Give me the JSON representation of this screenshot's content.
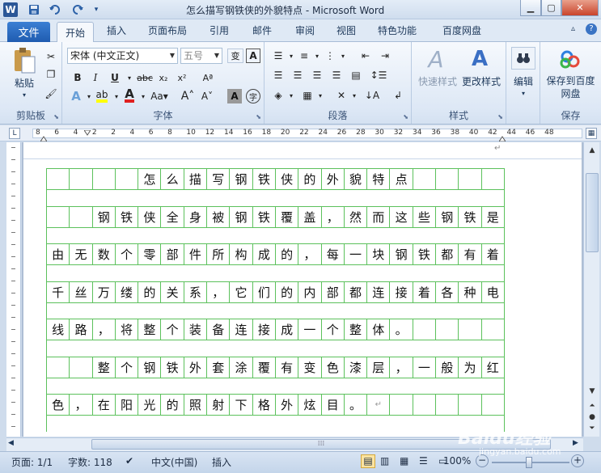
{
  "window": {
    "title": "怎么描写钢铁侠的外貌特点 - Microsoft Word",
    "app_icon": "W"
  },
  "quick_access": {
    "save_icon": "floppy-icon",
    "undo_icon": "undo-icon",
    "redo_icon": "redo-icon",
    "customize_icon": "dropdown-icon"
  },
  "tabs": {
    "file": "文件",
    "items": [
      "开始",
      "插入",
      "页面布局",
      "引用",
      "邮件",
      "审阅",
      "视图",
      "特色功能",
      "百度网盘"
    ]
  },
  "ribbon": {
    "clipboard": {
      "label": "剪贴板",
      "paste": "粘贴"
    },
    "font": {
      "label": "字体",
      "font_name": "宋体 (中文正文)",
      "font_size": "五号",
      "wen_btn": "变"
    },
    "paragraph": {
      "label": "段落"
    },
    "styles": {
      "label": "样式",
      "quick_styles": "快速样式",
      "change_styles": "更改样式"
    },
    "editing": {
      "label": "编辑"
    },
    "save": {
      "label": "保存",
      "save_to_baidu": "保存到百度网盘"
    }
  },
  "ruler": {
    "ticks": [
      "8",
      "6",
      "4",
      "2",
      "2",
      "4",
      "6",
      "8",
      "10",
      "12",
      "14",
      "16",
      "18",
      "20",
      "22",
      "24",
      "26",
      "28",
      "30",
      "32",
      "34",
      "36",
      "38",
      "40",
      "42",
      "44",
      "46",
      "48"
    ]
  },
  "document": {
    "rows": [
      [
        "",
        "",
        "",
        "",
        "怎",
        "么",
        "描",
        "写",
        "钢",
        "铁",
        "侠",
        "的",
        "外",
        "貌",
        "特",
        "点",
        "",
        "",
        "",
        ""
      ],
      [
        "",
        "",
        "钢",
        "铁",
        "侠",
        "全",
        "身",
        "被",
        "钢",
        "铁",
        "覆",
        "盖",
        "，",
        "然",
        "而",
        "这",
        "些",
        "钢",
        "铁",
        "是"
      ],
      [
        "由",
        "无",
        "数",
        "个",
        "零",
        "部",
        "件",
        "所",
        "构",
        "成",
        "的",
        "，",
        "每",
        "一",
        "块",
        "钢",
        "铁",
        "都",
        "有",
        "着"
      ],
      [
        "千",
        "丝",
        "万",
        "缕",
        "的",
        "关",
        "系",
        "，",
        "它",
        "们",
        "的",
        "内",
        "部",
        "都",
        "连",
        "接",
        "着",
        "各",
        "种",
        "电"
      ],
      [
        "线",
        "路",
        "，",
        "将",
        "整",
        "个",
        "装",
        "备",
        "连",
        "接",
        "成",
        "一",
        "个",
        "整",
        "体",
        "。",
        "",
        "",
        "",
        ""
      ],
      [
        "",
        "",
        "整",
        "个",
        "钢",
        "铁",
        "外",
        "套",
        "涂",
        "覆",
        "有",
        "变",
        "色",
        "漆",
        "层",
        "，",
        "一",
        "般",
        "为",
        "红"
      ],
      [
        "色",
        "，",
        "在",
        "阳",
        "光",
        "的",
        "照",
        "射",
        "下",
        "格",
        "外",
        "炫",
        "目",
        "。",
        "↵",
        "",
        "",
        "",
        "",
        ""
      ]
    ]
  },
  "statusbar": {
    "page": "页面: 1/1",
    "words": "字数: 118",
    "language": "中文(中国)",
    "mode": "插入",
    "zoom": "100%",
    "watermark": "Baidu经验",
    "watermark_url": "jingyan.baidu.com"
  },
  "colors": {
    "grid_green": "#5cc15c",
    "file_tab": "#2a6cc4"
  }
}
